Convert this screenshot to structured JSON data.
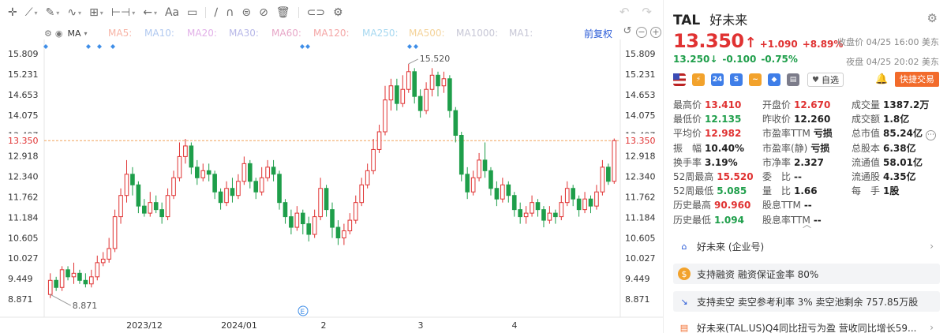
{
  "toolbar": {
    "tools": [
      "crosshair-icon",
      "line-icon",
      "pen-icon",
      "wave-icon",
      "fib-icon",
      "range-icon",
      "arrow-icon",
      "text-icon",
      "comment-icon",
      "ruler-icon",
      "magnet-icon",
      "lock-icon",
      "hide-icon",
      "delete-icon",
      "link-icon",
      "settings-icon"
    ],
    "text_tool": "Aa",
    "undo_icon": "undo-icon",
    "redo_icon": "redo-icon"
  },
  "ma_bar": {
    "settings_icon": "gear-icon",
    "eye_icon": "eye-icon",
    "selected": "MA",
    "items": [
      {
        "label": "MA5:",
        "color": "#f7b4a6"
      },
      {
        "label": "MA10:",
        "color": "#b1c9f0"
      },
      {
        "label": "MA20:",
        "color": "#e2b0e8"
      },
      {
        "label": "MA30:",
        "color": "#b8b8e8"
      },
      {
        "label": "MA60:",
        "color": "#e7a6c7"
      },
      {
        "label": "MA120:",
        "color": "#f4a6a6"
      },
      {
        "label": "MA250:",
        "color": "#a6d8f0"
      },
      {
        "label": "MA500:",
        "color": "#f4d39a"
      },
      {
        "label": "MA1000:",
        "color": "#c7c7d6"
      },
      {
        "label": "MA1:",
        "color": "#c7c7d6"
      }
    ],
    "adjust_label": "前复权"
  },
  "chart_data": {
    "type": "candlestick",
    "y_ticks": [
      "15.809",
      "15.231",
      "14.653",
      "14.075",
      "13.497",
      "12.918",
      "12.340",
      "11.762",
      "11.184",
      "10.605",
      "10.027",
      "9.449",
      "8.871"
    ],
    "y_range": [
      8.871,
      15.809
    ],
    "x_labels": [
      "2023/12",
      "2024/01",
      "2",
      "3",
      "4"
    ],
    "current_price_label": "13.350",
    "high_marker": "15.520",
    "low_marker": "8.871",
    "colors": {
      "up": "#e03232",
      "down": "#1e9e4a",
      "current_line": "#f2a45c"
    },
    "candles": [
      [
        9.0,
        9.4,
        9.6,
        8.9
      ],
      [
        9.4,
        9.2,
        9.5,
        9.1
      ],
      [
        9.2,
        9.7,
        9.8,
        9.1
      ],
      [
        9.7,
        9.5,
        9.8,
        9.4
      ],
      [
        9.5,
        9.6,
        9.9,
        9.3
      ],
      [
        9.6,
        9.4,
        9.7,
        9.3
      ],
      [
        9.4,
        9.3,
        9.6,
        9.2
      ],
      [
        9.3,
        9.5,
        9.7,
        9.2
      ],
      [
        9.5,
        9.9,
        10.1,
        9.4
      ],
      [
        9.9,
        10.0,
        10.2,
        9.8
      ],
      [
        10.0,
        10.3,
        10.6,
        9.9
      ],
      [
        10.3,
        11.2,
        11.4,
        10.2
      ],
      [
        11.2,
        11.8,
        12.0,
        11.0
      ],
      [
        11.8,
        12.4,
        12.8,
        11.6
      ],
      [
        12.4,
        12.1,
        12.6,
        11.8
      ],
      [
        12.1,
        11.5,
        12.2,
        11.3
      ],
      [
        11.5,
        11.3,
        11.7,
        11.2
      ],
      [
        11.3,
        11.6,
        11.9,
        11.2
      ],
      [
        11.6,
        11.4,
        11.8,
        11.3
      ],
      [
        11.4,
        11.2,
        11.6,
        11.0
      ],
      [
        11.2,
        11.8,
        12.0,
        11.1
      ],
      [
        11.8,
        12.3,
        12.5,
        11.7
      ],
      [
        12.3,
        12.9,
        13.3,
        12.2
      ],
      [
        12.9,
        13.2,
        13.4,
        12.7
      ],
      [
        13.2,
        12.6,
        13.3,
        12.4
      ],
      [
        12.6,
        12.3,
        12.8,
        12.1
      ],
      [
        12.3,
        12.5,
        12.7,
        12.2
      ],
      [
        12.5,
        12.4,
        12.7,
        12.2
      ],
      [
        12.4,
        11.9,
        12.5,
        11.7
      ],
      [
        11.9,
        11.6,
        12.0,
        11.4
      ],
      [
        11.6,
        12.0,
        12.2,
        11.5
      ],
      [
        12.0,
        11.8,
        12.3,
        11.6
      ],
      [
        11.8,
        12.2,
        12.4,
        11.7
      ],
      [
        12.2,
        12.7,
        12.9,
        12.1
      ],
      [
        12.7,
        12.2,
        12.8,
        12.0
      ],
      [
        12.2,
        11.9,
        12.3,
        11.7
      ],
      [
        11.9,
        12.3,
        12.6,
        11.8
      ],
      [
        12.3,
        12.6,
        12.8,
        12.2
      ],
      [
        12.6,
        12.4,
        12.8,
        12.2
      ],
      [
        12.4,
        11.6,
        12.5,
        11.4
      ],
      [
        11.6,
        11.2,
        11.7,
        11.0
      ],
      [
        11.2,
        10.9,
        11.4,
        10.7
      ],
      [
        10.9,
        11.3,
        11.5,
        10.8
      ],
      [
        11.3,
        11.0,
        11.4,
        10.7
      ],
      [
        11.0,
        10.7,
        11.2,
        10.5
      ],
      [
        10.7,
        11.2,
        11.4,
        10.6
      ],
      [
        11.2,
        12.0,
        12.3,
        11.1
      ],
      [
        12.0,
        11.4,
        12.1,
        11.2
      ],
      [
        11.4,
        10.9,
        11.6,
        10.6
      ],
      [
        10.9,
        10.6,
        11.1,
        10.4
      ],
      [
        10.6,
        10.8,
        11.0,
        10.4
      ],
      [
        10.8,
        11.1,
        11.3,
        10.7
      ],
      [
        11.1,
        11.6,
        11.8,
        11.0
      ],
      [
        11.6,
        12.1,
        12.3,
        11.5
      ],
      [
        12.1,
        12.5,
        12.7,
        12.0
      ],
      [
        12.5,
        13.1,
        13.4,
        12.4
      ],
      [
        13.1,
        13.6,
        13.8,
        13.0
      ],
      [
        13.6,
        14.5,
        14.9,
        13.5
      ],
      [
        14.5,
        14.9,
        15.1,
        14.2
      ],
      [
        14.9,
        14.4,
        15.1,
        14.2
      ],
      [
        14.4,
        14.8,
        15.2,
        14.3
      ],
      [
        14.8,
        15.3,
        15.52,
        14.7
      ],
      [
        15.3,
        14.6,
        15.4,
        14.4
      ],
      [
        14.6,
        14.2,
        14.8,
        14.0
      ],
      [
        14.2,
        14.8,
        15.0,
        14.1
      ],
      [
        14.8,
        15.2,
        15.4,
        14.6
      ],
      [
        15.2,
        14.9,
        15.3,
        14.6
      ],
      [
        14.9,
        15.1,
        15.3,
        14.7
      ],
      [
        15.1,
        14.2,
        15.2,
        14.0
      ],
      [
        14.2,
        13.5,
        14.3,
        13.3
      ],
      [
        13.5,
        12.4,
        13.6,
        12.2
      ],
      [
        12.4,
        11.9,
        12.6,
        11.7
      ],
      [
        11.9,
        12.3,
        12.5,
        11.8
      ],
      [
        12.3,
        12.8,
        13.0,
        12.2
      ],
      [
        12.8,
        12.5,
        13.3,
        12.3
      ],
      [
        12.5,
        12.0,
        12.6,
        11.8
      ],
      [
        12.0,
        11.7,
        12.2,
        11.5
      ],
      [
        11.7,
        12.1,
        12.3,
        11.6
      ],
      [
        12.1,
        11.8,
        12.2,
        11.6
      ],
      [
        11.8,
        11.4,
        11.9,
        11.2
      ],
      [
        11.4,
        11.2,
        11.6,
        11.0
      ],
      [
        11.2,
        11.3,
        11.5,
        11.0
      ],
      [
        11.3,
        11.6,
        11.8,
        11.2
      ],
      [
        11.6,
        11.4,
        11.7,
        11.2
      ],
      [
        11.4,
        11.1,
        11.5,
        10.9
      ],
      [
        11.1,
        11.3,
        11.5,
        11.0
      ],
      [
        11.3,
        11.2,
        11.4,
        11.0
      ],
      [
        11.2,
        11.6,
        11.8,
        11.1
      ],
      [
        11.6,
        12.0,
        12.2,
        11.5
      ],
      [
        12.0,
        11.7,
        12.1,
        11.5
      ],
      [
        11.7,
        11.4,
        11.8,
        11.2
      ],
      [
        11.4,
        11.7,
        11.9,
        11.3
      ],
      [
        11.7,
        11.5,
        11.8,
        11.3
      ],
      [
        11.5,
        11.9,
        12.1,
        11.4
      ],
      [
        11.9,
        12.6,
        12.8,
        11.8
      ],
      [
        12.6,
        12.2,
        12.7,
        12.1
      ],
      [
        12.2,
        13.35,
        13.41,
        12.13
      ]
    ]
  },
  "quote": {
    "symbol": "TAL",
    "name": "好未来",
    "price": "13.350",
    "arrow": "↑",
    "change": "+1.090",
    "change_pct": "+8.89%",
    "close_time": "收盘价 04/25 16:00 美东",
    "night_price": "13.250",
    "night_arrow": "↓",
    "night_change": "-0.100",
    "night_pct": "-0.75%",
    "night_time": "夜盘 04/25 20:02 美东",
    "watch_label": "自选",
    "trade_label": "快捷交易"
  },
  "badges": [
    {
      "icon": "us-flag-icon",
      "text": "",
      "color": "#3b5bb5"
    },
    {
      "icon": "lightning-icon",
      "text": "⚡",
      "color": "#f2a22c"
    },
    {
      "icon": "24h-icon",
      "text": "24",
      "color": "#3f7ee8"
    },
    {
      "icon": "s-icon",
      "text": "S",
      "color": "#3f7ee8"
    },
    {
      "icon": "trend-icon",
      "text": "~",
      "color": "#f2a22c"
    },
    {
      "icon": "tag-icon",
      "text": "◆",
      "color": "#3f7ee8"
    },
    {
      "icon": "doc-icon",
      "text": "▤",
      "color": "#7c7c8a"
    }
  ],
  "stats": {
    "col1": [
      {
        "k": "最高价",
        "v": "13.410",
        "tone": "red"
      },
      {
        "k": "最低价",
        "v": "12.135",
        "tone": "green"
      },
      {
        "k": "平均价",
        "v": "12.982",
        "tone": "red"
      },
      {
        "k": "振　幅",
        "v": "10.40%",
        "tone": ""
      },
      {
        "k": "换手率",
        "v": "3.19%",
        "tone": ""
      },
      {
        "k": "52周最高",
        "v": "15.520",
        "tone": "red"
      },
      {
        "k": "52周最低",
        "v": "5.085",
        "tone": "green"
      },
      {
        "k": "历史最高",
        "v": "90.960",
        "tone": "red"
      },
      {
        "k": "历史最低",
        "v": "1.094",
        "tone": "green"
      }
    ],
    "col2": [
      {
        "k": "开盘价",
        "v": "12.670",
        "tone": "red"
      },
      {
        "k": "昨收价",
        "v": "12.260",
        "tone": ""
      },
      {
        "k": "市盈率TTM",
        "v": "亏损",
        "tone": ""
      },
      {
        "k": "市盈率(静)",
        "v": "亏损",
        "tone": ""
      },
      {
        "k": "市净率",
        "v": "2.327",
        "tone": ""
      },
      {
        "k": "委　比",
        "v": "--",
        "tone": ""
      },
      {
        "k": "量　比",
        "v": "1.66",
        "tone": ""
      },
      {
        "k": "股息TTM",
        "v": "--",
        "tone": ""
      },
      {
        "k": "股息率TTM",
        "v": "--",
        "tone": ""
      }
    ],
    "col3": [
      {
        "k": "成交量",
        "v": "1387.2万",
        "tone": ""
      },
      {
        "k": "成交额",
        "v": "1.8亿",
        "tone": ""
      },
      {
        "k": "总市值",
        "v": "85.24亿",
        "tone": ""
      },
      {
        "k": "总股本",
        "v": "6.38亿",
        "tone": ""
      },
      {
        "k": "流通值",
        "v": "58.01亿",
        "tone": ""
      },
      {
        "k": "流通股",
        "v": "4.35亿",
        "tone": ""
      },
      {
        "k": "每　手",
        "v": "1股",
        "tone": ""
      }
    ]
  },
  "info_cards": [
    {
      "icon": "building-icon",
      "text": "好未来 (企业号)",
      "style": "plain",
      "icon_color": "#2a5bd7",
      "has_arrow": true
    },
    {
      "icon": "dollar-icon",
      "text": "支持融资 融资保证金率 80%",
      "style": "grey",
      "icon_color": "#f2a22c",
      "has_arrow": false
    },
    {
      "icon": "chart-down-icon",
      "text": "支持卖空 卖空参考利率 3% 卖空池剩余 757.85万股",
      "style": "grey",
      "icon_color": "#2a5bd7",
      "has_arrow": false
    },
    {
      "icon": "news-icon",
      "text": "好未来(TAL.US)Q4同比扭亏为盈 营收同比增长59...",
      "style": "plain",
      "icon_color": "#f26b2b",
      "has_arrow": true
    }
  ]
}
